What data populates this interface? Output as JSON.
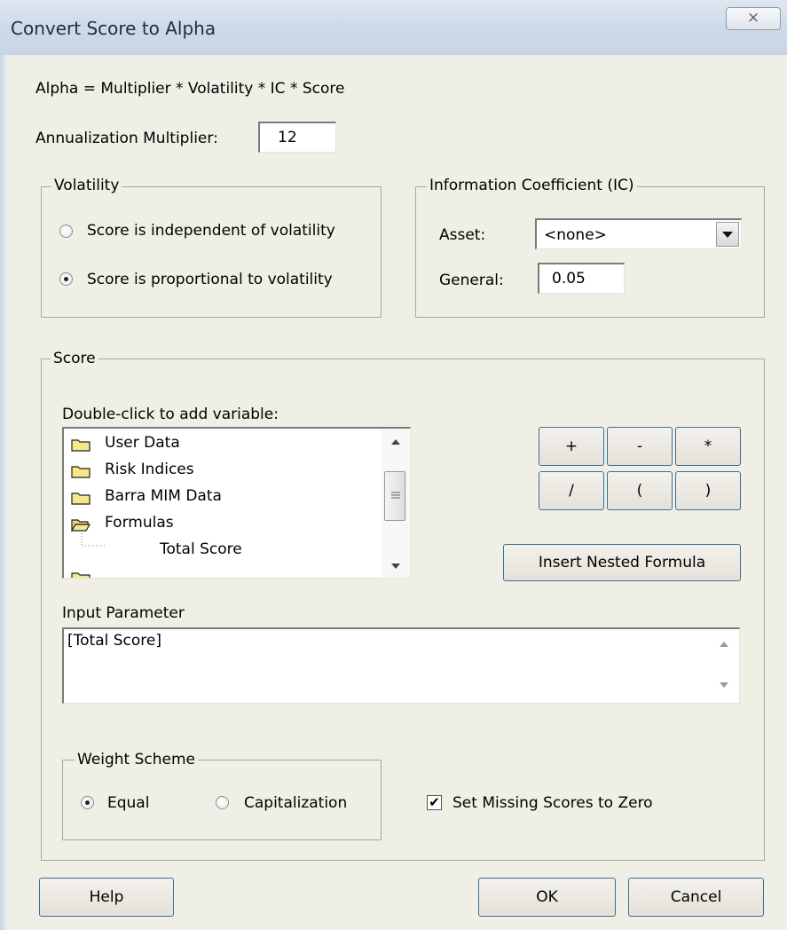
{
  "window": {
    "title": "Convert Score to Alpha",
    "close_glyph": "⨯"
  },
  "formula_text": "Alpha = Multiplier * Volatility * IC * Score",
  "annualization": {
    "label": "Annualization Multiplier:",
    "value": "12"
  },
  "volatility": {
    "title": "Volatility",
    "option_independent": "Score is independent of volatility",
    "option_proportional": "Score is proportional to volatility",
    "selected": "proportional"
  },
  "ic": {
    "title": "Information Coefficient (IC)",
    "asset_label": "Asset:",
    "asset_value": "<none>",
    "general_label": "General:",
    "general_value": "0.05"
  },
  "score": {
    "title": "Score",
    "tree_label": "Double-click to add variable:",
    "tree_items": [
      {
        "label": "User Data",
        "icon": "folder-icon"
      },
      {
        "label": "Risk Indices",
        "icon": "folder-icon"
      },
      {
        "label": "Barra MIM Data",
        "icon": "folder-icon"
      },
      {
        "label": "Formulas",
        "icon": "folder-open-icon"
      },
      {
        "label": "Total Score",
        "icon": ""
      }
    ],
    "operators": [
      "+",
      "-",
      "*",
      "/",
      "(",
      ")"
    ],
    "insert_nested_label": "Insert Nested Formula",
    "input_param_label": "Input Parameter",
    "input_param_value": "[Total Score]"
  },
  "weight": {
    "title": "Weight Scheme",
    "option_equal": "Equal",
    "option_cap": "Capitalization",
    "selected": "equal"
  },
  "missing": {
    "label": "Set Missing Scores to Zero",
    "checked": true,
    "check_glyph": "✔"
  },
  "buttons": {
    "help": "Help",
    "ok": "OK",
    "cancel": "Cancel"
  },
  "colors": {
    "dialog_bg": "#f0efe6",
    "button_border": "#3c6e96",
    "titlebar": "#cfdbe9"
  }
}
